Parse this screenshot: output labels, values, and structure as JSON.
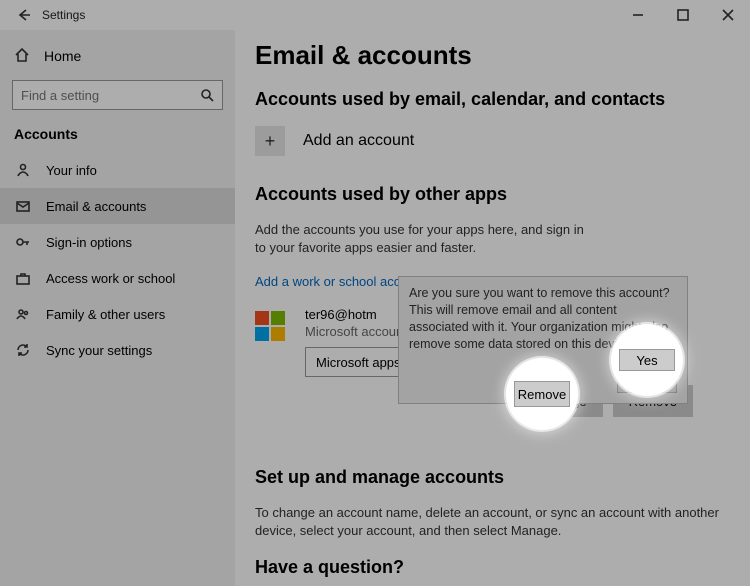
{
  "titlebar": {
    "title": "Settings"
  },
  "sidebar": {
    "home": "Home",
    "search_placeholder": "Find a setting",
    "category": "Accounts",
    "items": [
      {
        "label": "Your info"
      },
      {
        "label": "Email & accounts"
      },
      {
        "label": "Sign-in options"
      },
      {
        "label": "Access work or school"
      },
      {
        "label": "Family & other users"
      },
      {
        "label": "Sync your settings"
      }
    ]
  },
  "page": {
    "title": "Email & accounts",
    "section1_title": "Accounts used by email, calendar, and contacts",
    "add_account": "Add an account",
    "section2_title": "Accounts used by other apps",
    "section2_desc": "Add the accounts you use for your apps here, and sign in to your favorite apps easier and faster.",
    "add_work": "Add a work or school account",
    "account": {
      "email": "ter96@hotm",
      "type": "Microsoft account",
      "select_text": "Microsoft apps can"
    },
    "manage": "Manage",
    "remove": "Remove",
    "section3_title": "Set up and manage accounts",
    "section3_desc": "To change an account name, delete an account, or sync an account with another device, select your account, and then select Manage.",
    "section4_title": "Have a question?"
  },
  "dialog": {
    "text": "Are you sure you want to remove this account? This will remove email and all content associated with it. Your organization might also remove some data stored on this device.",
    "yes": "Yes"
  }
}
